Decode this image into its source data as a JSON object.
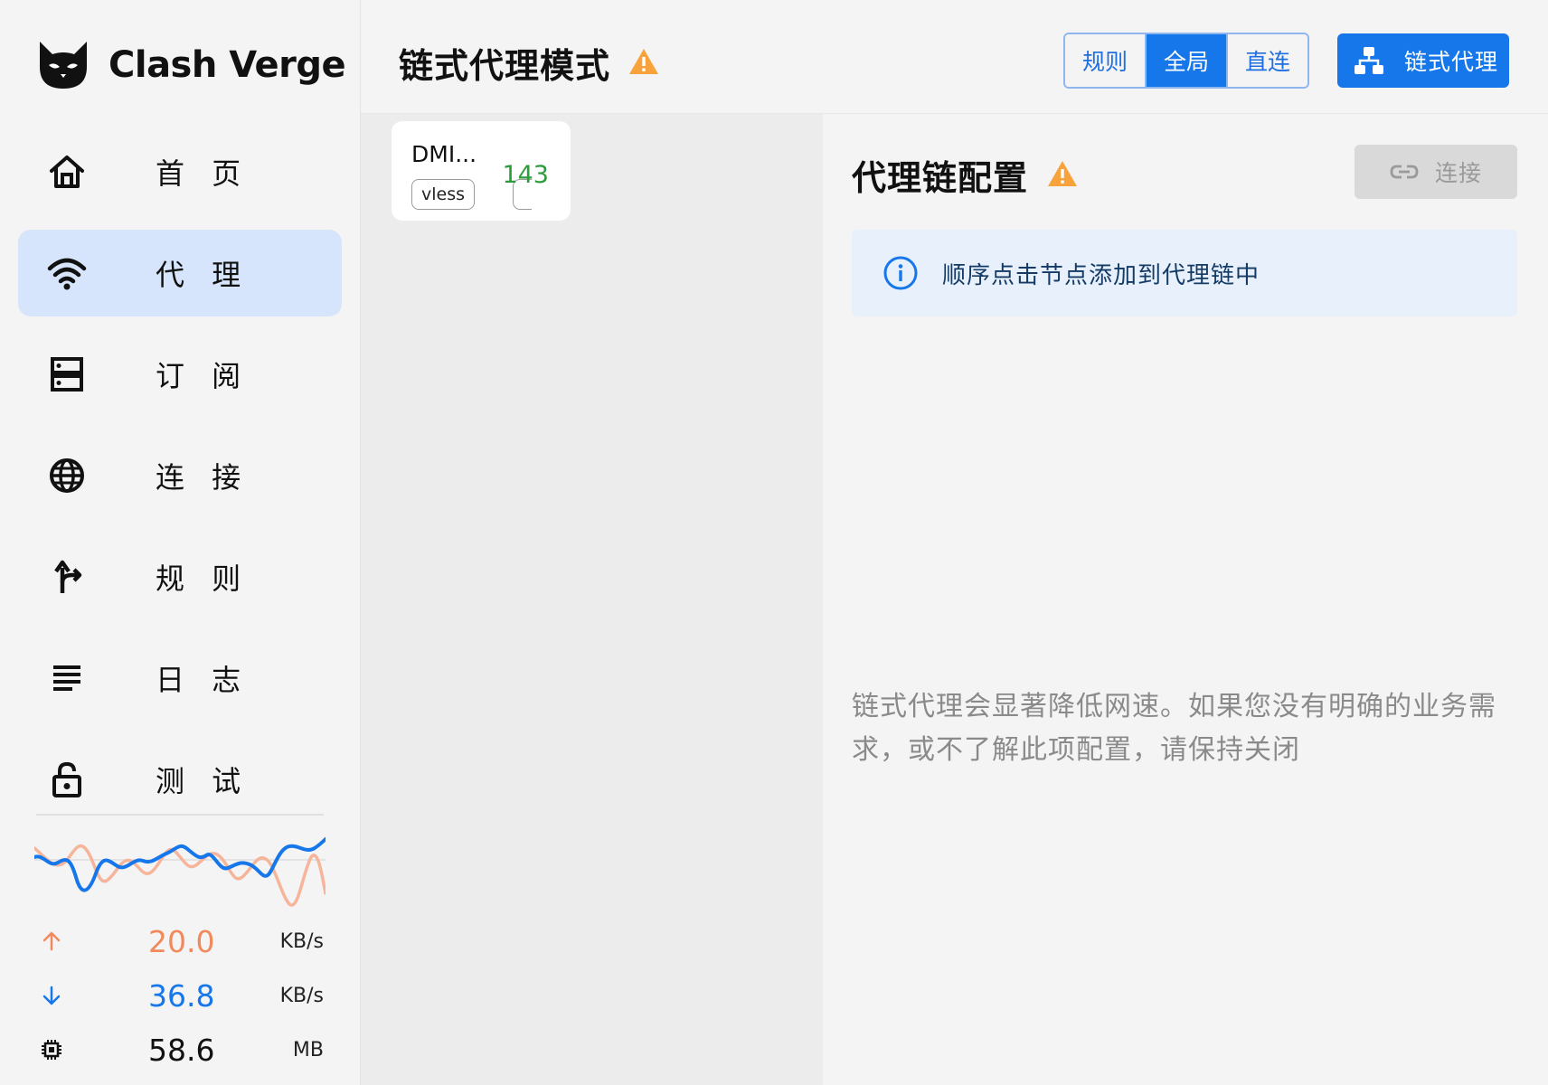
{
  "app": {
    "name": "Clash Verge"
  },
  "sidebar": {
    "items": [
      {
        "label": "首 页",
        "icon": "home-icon",
        "active": false
      },
      {
        "label": "代 理",
        "icon": "wifi-icon",
        "active": true
      },
      {
        "label": "订 阅",
        "icon": "server-icon",
        "active": false
      },
      {
        "label": "连 接",
        "icon": "globe-icon",
        "active": false
      },
      {
        "label": "规 则",
        "icon": "fork-arrow-icon",
        "active": false
      },
      {
        "label": "日 志",
        "icon": "lines-icon",
        "active": false
      },
      {
        "label": "测 试",
        "icon": "lock-icon",
        "active": false
      }
    ],
    "stats": {
      "upload": {
        "value": "20.0",
        "unit": "KB/s",
        "color": "#f08a5d"
      },
      "download": {
        "value": "36.8",
        "unit": "KB/s",
        "color": "#1677ea"
      },
      "memory": {
        "value": "58.6",
        "unit": "MB",
        "color": "#111111"
      }
    }
  },
  "header": {
    "title": "链式代理模式",
    "modes": [
      {
        "label": "规则",
        "selected": false
      },
      {
        "label": "全局",
        "selected": true
      },
      {
        "label": "直连",
        "selected": false
      }
    ],
    "chain_button": "链式代理"
  },
  "proxy_list": {
    "cards": [
      {
        "name": "DMI...",
        "type": "vless",
        "delay": "143"
      }
    ]
  },
  "chain_panel": {
    "title": "代理链配置",
    "connect_button": "连接",
    "info": "顺序点击节点添加到代理链中",
    "warning": "链式代理会显著降低网速。如果您没有明确的业务需求，或不了解此项配置，请保持关闭"
  },
  "colors": {
    "accent": "#1677ea",
    "warning": "#f7a23b",
    "active_nav": "#d6e5fb",
    "delay_good": "#2a9d3a"
  }
}
